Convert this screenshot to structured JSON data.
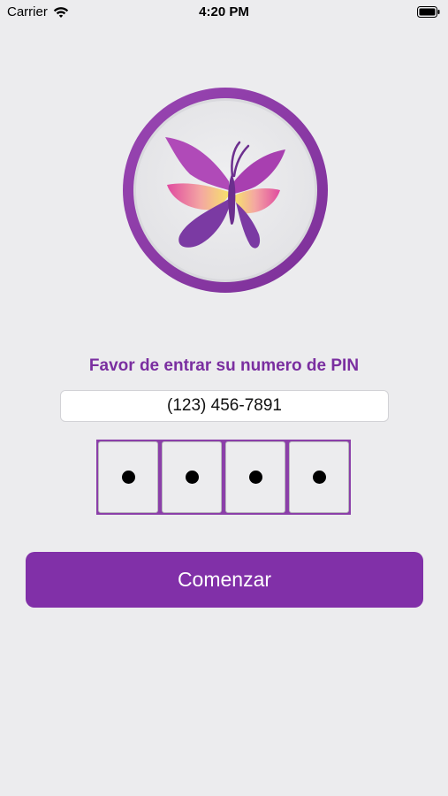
{
  "status_bar": {
    "carrier": "Carrier",
    "time": "4:20 PM",
    "icons": [
      "wifi-icon",
      "battery-icon"
    ]
  },
  "logo": {
    "icon": "butterfly-logo",
    "ring_color": "#8a3aa6"
  },
  "form": {
    "prompt": "Favor de entrar su numero de PIN",
    "phone_value": "(123) 456-7891",
    "pin_digits_entered": 4,
    "pin_length": 4,
    "pin_mask": "•"
  },
  "actions": {
    "start_label": "Comenzar",
    "start_color": "#8130a8"
  },
  "colors": {
    "accent": "#8130a8",
    "prompt_text": "#7a2ea0",
    "background": "#ececee"
  }
}
